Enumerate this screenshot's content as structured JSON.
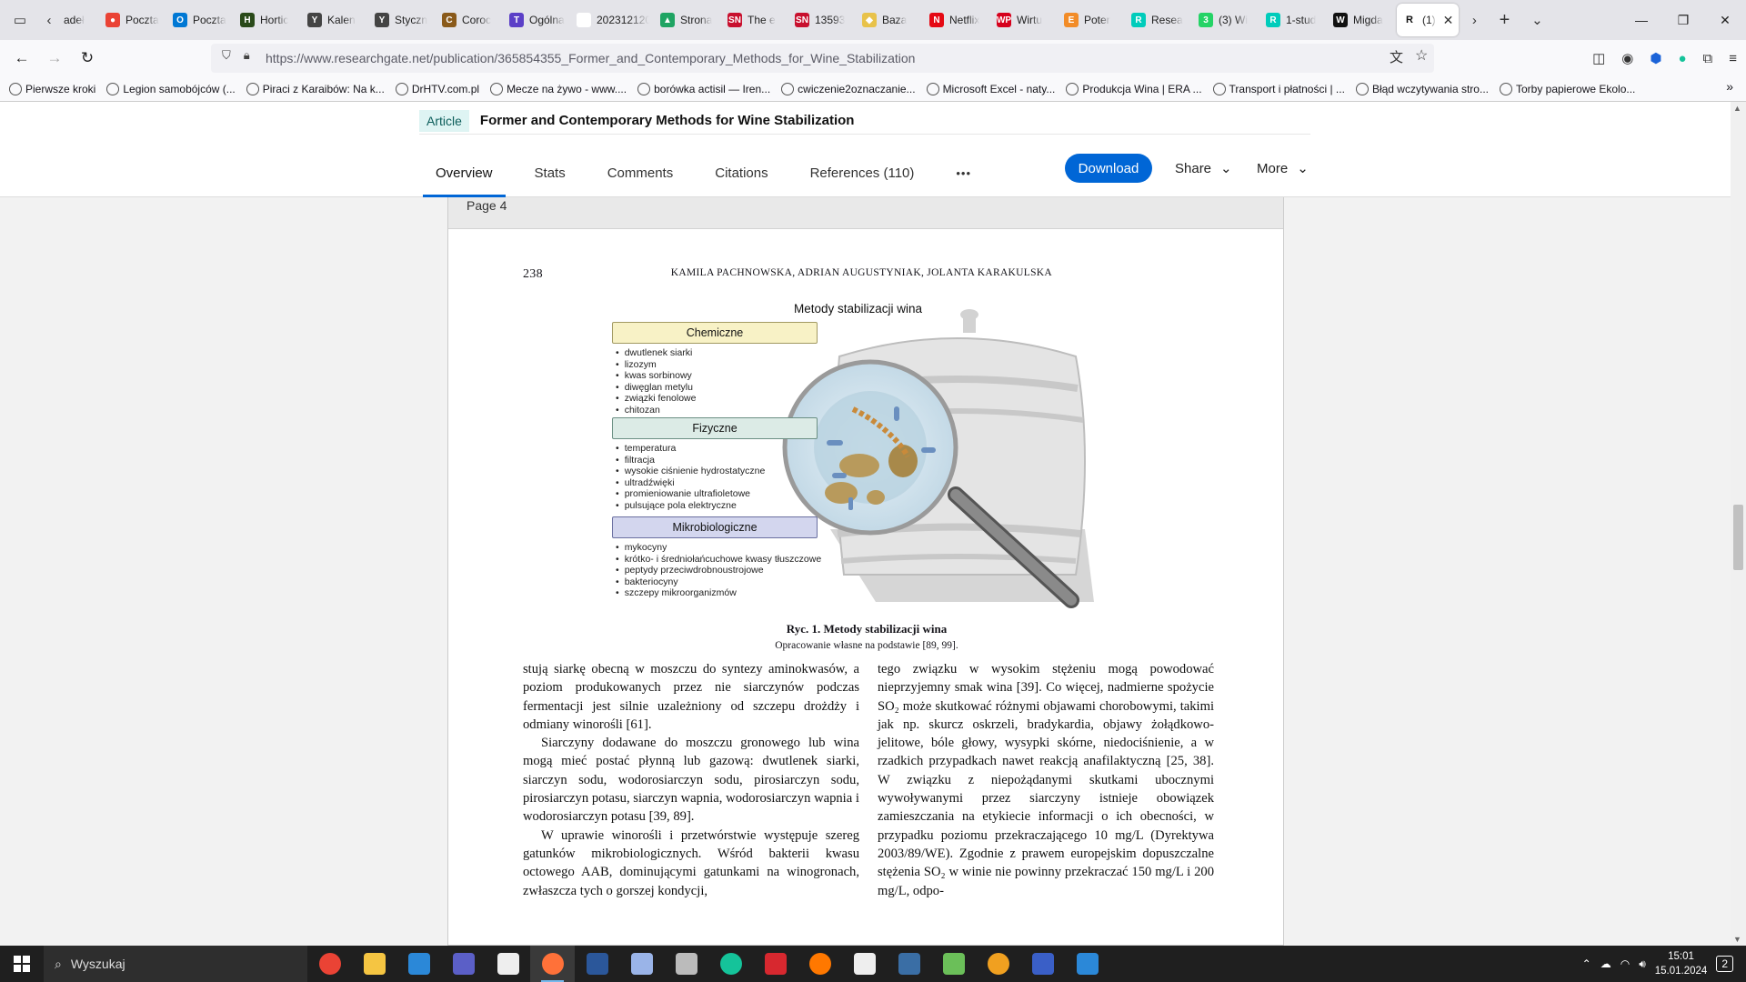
{
  "browser": {
    "tabs": [
      {
        "title": "adeł",
        "color": "#888888",
        "glyph": ""
      },
      {
        "title": "Poczta",
        "color": "#ea4335",
        "glyph": "●"
      },
      {
        "title": "Poczta",
        "color": "#0078d4",
        "glyph": "O"
      },
      {
        "title": "Hortic",
        "color": "#2a4a1a",
        "glyph": "H"
      },
      {
        "title": "Kalen",
        "color": "#444444",
        "glyph": "Y"
      },
      {
        "title": "Styczn",
        "color": "#444444",
        "glyph": "Y"
      },
      {
        "title": "Coroc",
        "color": "#8a5a1a",
        "glyph": "C"
      },
      {
        "title": "Ogólna",
        "color": "#5b3fc7",
        "glyph": "T"
      },
      {
        "title": "2023121209",
        "color": "#ffffff",
        "glyph": ""
      },
      {
        "title": "Strona",
        "color": "#1fa463",
        "glyph": "▲"
      },
      {
        "title": "The e",
        "color": "#c8102e",
        "glyph": "SN"
      },
      {
        "title": "13593",
        "color": "#c8102e",
        "glyph": "SN"
      },
      {
        "title": "Baza",
        "color": "#e8c24a",
        "glyph": "◆"
      },
      {
        "title": "Netflix",
        "color": "#e50914",
        "glyph": "N"
      },
      {
        "title": "Wirtu",
        "color": "#d6001c",
        "glyph": "WP"
      },
      {
        "title": "Poter",
        "color": "#f28c28",
        "glyph": "E"
      },
      {
        "title": "Resea",
        "color": "#00ccbb",
        "glyph": "R"
      },
      {
        "title": "(3) Wi",
        "color": "#25d366",
        "glyph": "3"
      },
      {
        "title": "1-stud",
        "color": "#00ccbb",
        "glyph": "R"
      },
      {
        "title": "Migda",
        "color": "#111111",
        "glyph": "W"
      }
    ],
    "active_tab": {
      "title": "(1)",
      "glyph": "R"
    },
    "url_host": "https://www.researchgate.net",
    "url_path": "/publication/365854355_Former_and_Contemporary_Methods_for_Wine_Stabilization",
    "bookmarks": [
      "Pierwsze kroki",
      "Legion samobójców (...",
      "Piraci z Karaibów: Na k...",
      "DrHTV.com.pl",
      "Mecze na żywo - www....",
      "borówka actisil — Iren...",
      "cwiczenie2oznaczanie...",
      "Microsoft Excel - naty...",
      "Produkcja Wina | ERA ...",
      "Transport i płatności | ...",
      "Błąd wczytywania stro...",
      "Torby papierowe Ekolo..."
    ]
  },
  "rg": {
    "badge": "Article",
    "title": "Former and Contemporary Methods for Wine Stabilization",
    "tabs": [
      "Overview",
      "Stats",
      "Comments",
      "Citations",
      "References (110)"
    ],
    "more_dots": "•••",
    "download": "Download",
    "share": "Share",
    "more": "More",
    "page_label": "Page 4"
  },
  "pdf": {
    "page_number": "238",
    "running_head": "KAMILA PACHNOWSKA, ADRIAN AUGUSTYNIAK, JOLANTA KARAKULSKA",
    "figure_title": "Metody stabilizacji wina",
    "categories": [
      {
        "name": "Chemiczne",
        "items": [
          "dwutlenek siarki",
          "lizozym",
          "kwas sorbinowy",
          "diwęglan metylu",
          "związki fenolowe",
          "chitozan"
        ]
      },
      {
        "name": "Fizyczne",
        "items": [
          "temperatura",
          "filtracja",
          "wysokie ciśnienie hydrostatyczne",
          "ultradźwięki",
          "promieniowanie ultrafioletowe",
          "pulsujące pola elektryczne"
        ]
      },
      {
        "name": "Mikrobiologiczne",
        "items": [
          "mykocyny",
          "krótko- i średniołańcuchowe kwasy tłuszczowe",
          "peptydy przeciwdrobnoustrojowe",
          "bakteriocyny",
          "szczepy mikroorganizmów"
        ]
      }
    ],
    "caption_title": "Ryc. 1. Metody stabilizacji wina",
    "caption_note": "Opracowanie własne na podstawie [89, 99].",
    "col1": [
      "stują siarkę obecną w moszczu do syntezy aminokwasów, a poziom produkowanych przez nie siarczynów podczas fermentacji jest silnie uzależniony od szczepu drożdży i odmiany winorośli [61].",
      "Siarczyny dodawane do moszczu gronowego lub wina mogą mieć postać płynną lub gazową: dwutlenek siarki, siarczyn sodu, wodorosiarczyn sodu, pirosiarczyn sodu, pirosiarczyn potasu, siarczyn wapnia, wodorosiarczyn wapnia i wodorosiarczyn potasu [39, 89].",
      "W uprawie winorośli i przetwórstwie występuje szereg gatunków mikrobiologicznych. Wśród bakterii kwasu octowego AAB, dominującymi gatunkami na winogronach, zwłaszcza tych o gorszej kondycji,"
    ],
    "col2": "tego związku w wysokim stężeniu mogą powodować nieprzyjemny smak wina [39]. Co więcej, nadmierne spożycie SO₂ może skutkować różnymi objawami chorobowymi, takimi jak np. skurcz oskrzeli, bradykardia, objawy żołądkowo-jelitowe, bóle głowy, wysypki skórne, niedociśnienie, a w rzadkich przypadkach nawet reakcją anafilaktyczną [25, 38]. W związku z niepożądanymi skutkami ubocznymi wywoływanymi przez siarczyny istnieje obowiązek zamieszczania na etykiecie informacji o ich obecności, w przypadku poziomu przekraczającego 10 mg/L (Dyrektywa 2003/89/WE). Zgodnie z prawem europejskim dopuszczalne stężenia SO₂ w winie nie powinny przekraczać 150 mg/L i 200 mg/L, odpo-"
  },
  "taskbar": {
    "search_placeholder": "Wyszukaj",
    "time": "15:01",
    "date": "15.01.2024",
    "notifications": "2",
    "apps": [
      {
        "name": "chrome",
        "color": "#ea4335"
      },
      {
        "name": "explorer",
        "color": "#f5c542"
      },
      {
        "name": "mail",
        "color": "#2b88d8"
      },
      {
        "name": "teams",
        "color": "#5b5fc7"
      },
      {
        "name": "file",
        "color": "#eeeeee"
      },
      {
        "name": "firefox",
        "color": "#ff7139"
      },
      {
        "name": "word",
        "color": "#2b579a"
      },
      {
        "name": "feather",
        "color": "#9ab4e8"
      },
      {
        "name": "app",
        "color": "#bbbbbb"
      },
      {
        "name": "grammarly",
        "color": "#15c39a"
      },
      {
        "name": "acrobat",
        "color": "#d7282f"
      },
      {
        "name": "avast",
        "color": "#ff7800"
      },
      {
        "name": "ocr",
        "color": "#eeeeee"
      },
      {
        "name": "vpn",
        "color": "#3a6ea5"
      },
      {
        "name": "photos",
        "color": "#6bbf59"
      },
      {
        "name": "disc",
        "color": "#f0a020"
      },
      {
        "name": "save",
        "color": "#3a5fc7"
      },
      {
        "name": "whiteboard",
        "color": "#2b88d8"
      }
    ]
  }
}
